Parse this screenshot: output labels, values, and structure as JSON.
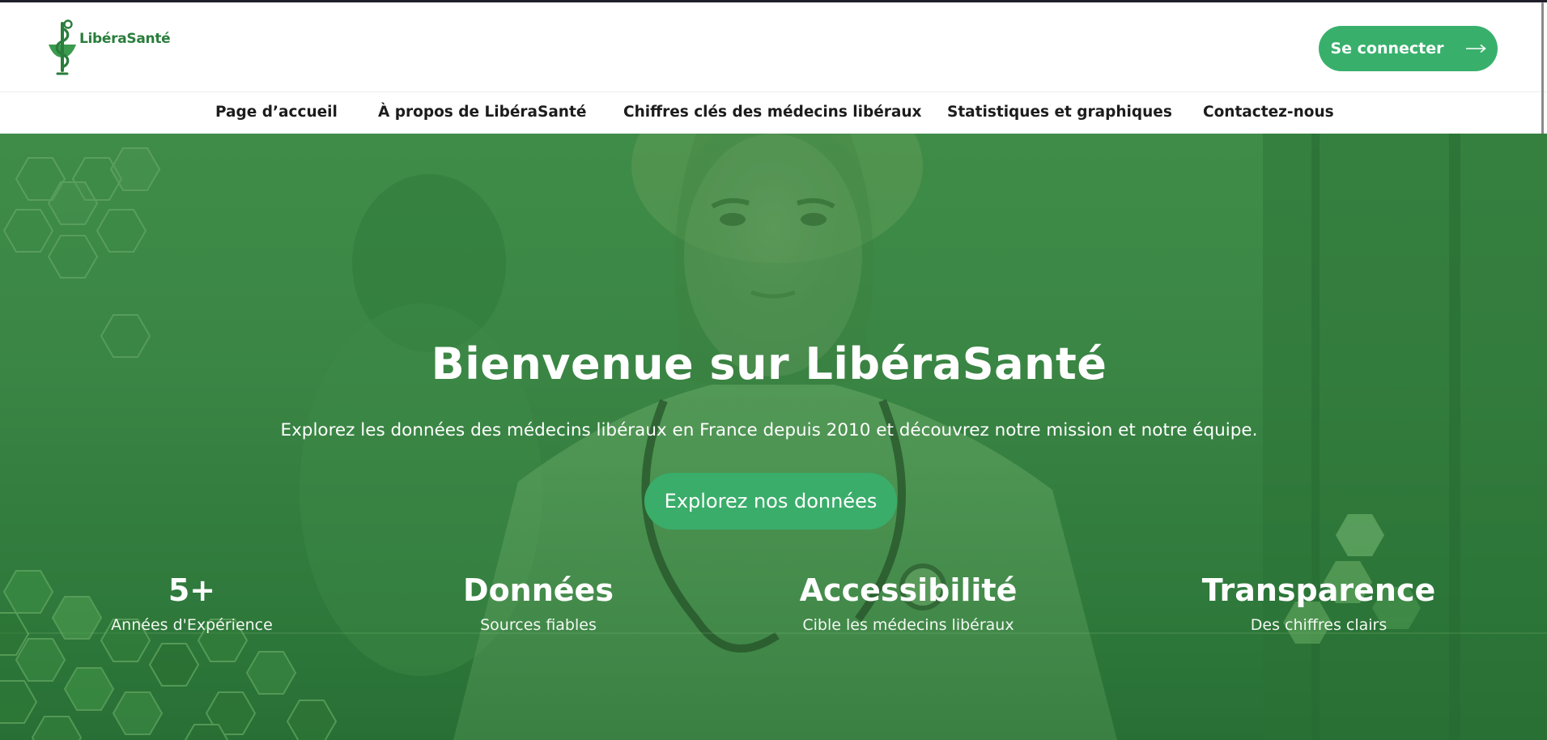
{
  "brand": {
    "name": "LibéraSanté",
    "logo_icon": "caduceus-bowl-icon",
    "primary_color": "#38b06c",
    "dark_green": "#2a7d3c"
  },
  "header": {
    "login_label": "Se connecter",
    "login_icon": "arrow-right-icon"
  },
  "nav": {
    "items": [
      {
        "label": "Page d’accueil"
      },
      {
        "label": "À propos de LibéraSanté"
      },
      {
        "label": "Chiffres clés des médecins libéraux"
      },
      {
        "label": "Statistiques et graphiques"
      },
      {
        "label": "Contactez-nous"
      }
    ]
  },
  "hero": {
    "title": "Bienvenue sur LibéraSanté",
    "subtitle": "Explorez les données des médecins libéraux en France depuis 2010 et découvrez notre mission et notre équipe.",
    "cta_label": "Explorez nos données",
    "overlay_color": "#3a8a45",
    "stats": [
      {
        "value": "5+",
        "label": "Années d'Expérience"
      },
      {
        "value": "Données",
        "label": "Sources fiables"
      },
      {
        "value": "Accessibilité",
        "label": "Cible les médecins libéraux"
      },
      {
        "value": "Transparence",
        "label": "Des chiffres clairs"
      }
    ]
  }
}
